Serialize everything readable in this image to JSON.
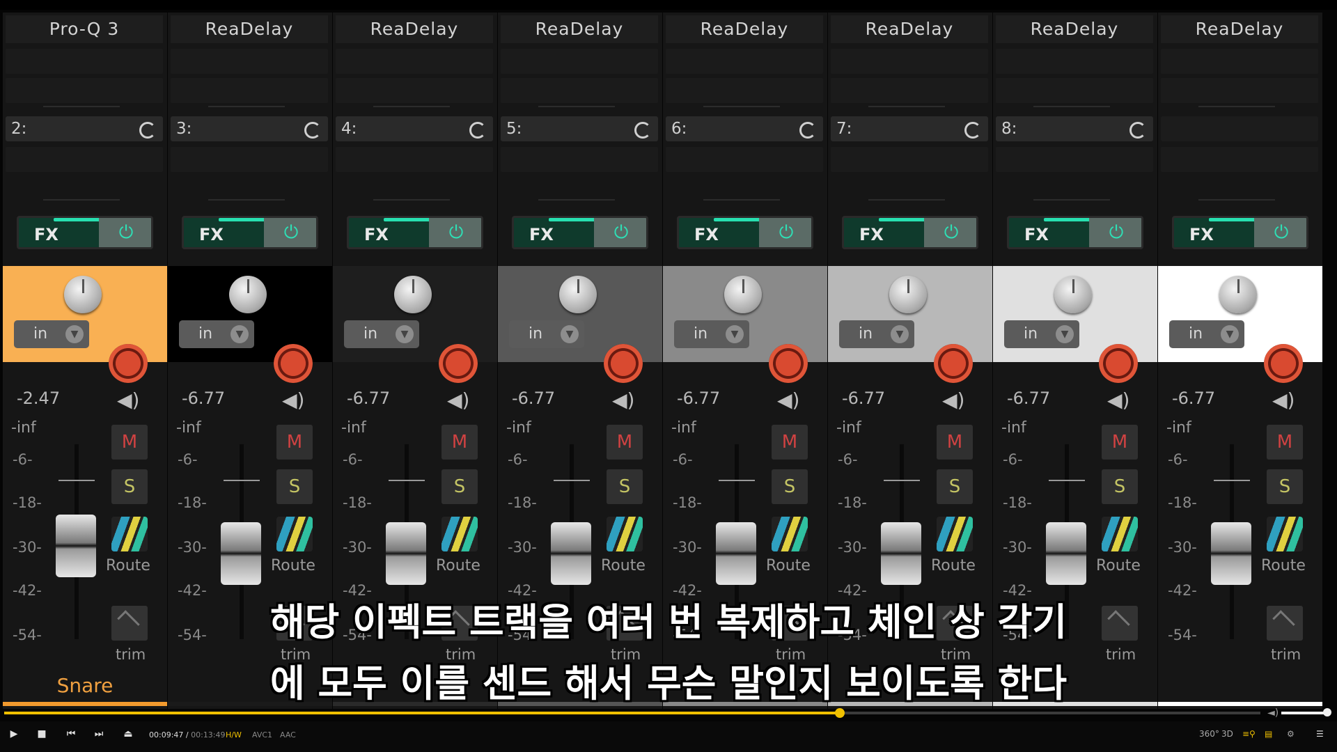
{
  "mixer": {
    "strips": [
      {
        "fx_name": "Pro-Q 3",
        "send": "2:",
        "track_color": "#f9b053",
        "volume": "-2.47",
        "peak": "-inf",
        "name": "Snare",
        "stripe": "#f29a2e",
        "fader_level": 0.62
      },
      {
        "fx_name": "ReaDelay",
        "send": "3:",
        "track_color": "#000000",
        "volume": "-6.77",
        "peak": "-inf",
        "name": "",
        "stripe": "#1a1a1a",
        "fader_level": 0.55
      },
      {
        "fx_name": "ReaDelay",
        "send": "4:",
        "track_color": "#1e1e1e",
        "volume": "-6.77",
        "peak": "-inf",
        "name": "",
        "stripe": "#2a2a2a",
        "fader_level": 0.55
      },
      {
        "fx_name": "ReaDelay",
        "send": "5:",
        "track_color": "#585858",
        "volume": "-6.77",
        "peak": "-inf",
        "name": "",
        "stripe": "#555555",
        "fader_level": 0.55
      },
      {
        "fx_name": "ReaDelay",
        "send": "6:",
        "track_color": "#8a8a8a",
        "volume": "-6.77",
        "peak": "-inf",
        "name": "",
        "stripe": "#888888",
        "fader_level": 0.55
      },
      {
        "fx_name": "ReaDelay",
        "send": "7:",
        "track_color": "#b8b8b8",
        "volume": "-6.77",
        "peak": "-inf",
        "name": "",
        "stripe": "#b8b8b8",
        "fader_level": 0.55
      },
      {
        "fx_name": "ReaDelay",
        "send": "8:",
        "track_color": "#e0e0e0",
        "volume": "-6.77",
        "peak": "-inf",
        "name": "",
        "stripe": "#e0e0e0",
        "fader_level": 0.55
      },
      {
        "fx_name": "ReaDelay",
        "send": "",
        "track_color": "#ffffff",
        "volume": "-6.77",
        "peak": "-inf",
        "name": "",
        "stripe": "#ffffff",
        "fader_level": 0.55
      }
    ],
    "labels": {
      "fx": "FX",
      "in": "in",
      "mute": "M",
      "solo": "S",
      "route": "Route",
      "trim": "trim"
    },
    "scale": [
      "-6-",
      "-18-",
      "-30-",
      "-42-",
      "-54-"
    ]
  },
  "subtitle": {
    "line1": "해당 이펙트 트랙을 여러 번 복제하고 체인 상 각기",
    "line2": "에 모두 이를 센드 해서 무슨 말인지 보이도록 한다"
  },
  "player": {
    "current_time": "00:09:47",
    "total_time": "00:13:49",
    "progress": 0.665,
    "volume": 0.9,
    "badges": [
      "H/W",
      "AVC1",
      "AAC"
    ],
    "accent": "#f0c000",
    "icons": [
      "play-icon",
      "stop-icon",
      "prev-icon",
      "next-icon",
      "eject-icon",
      "360-icon",
      "3d-icon",
      "search-playlist-icon",
      "subtitle-icon",
      "settings-icon",
      "menu-icon"
    ],
    "right_labels": {
      "vr": "360°",
      "three_d": "3D"
    }
  }
}
